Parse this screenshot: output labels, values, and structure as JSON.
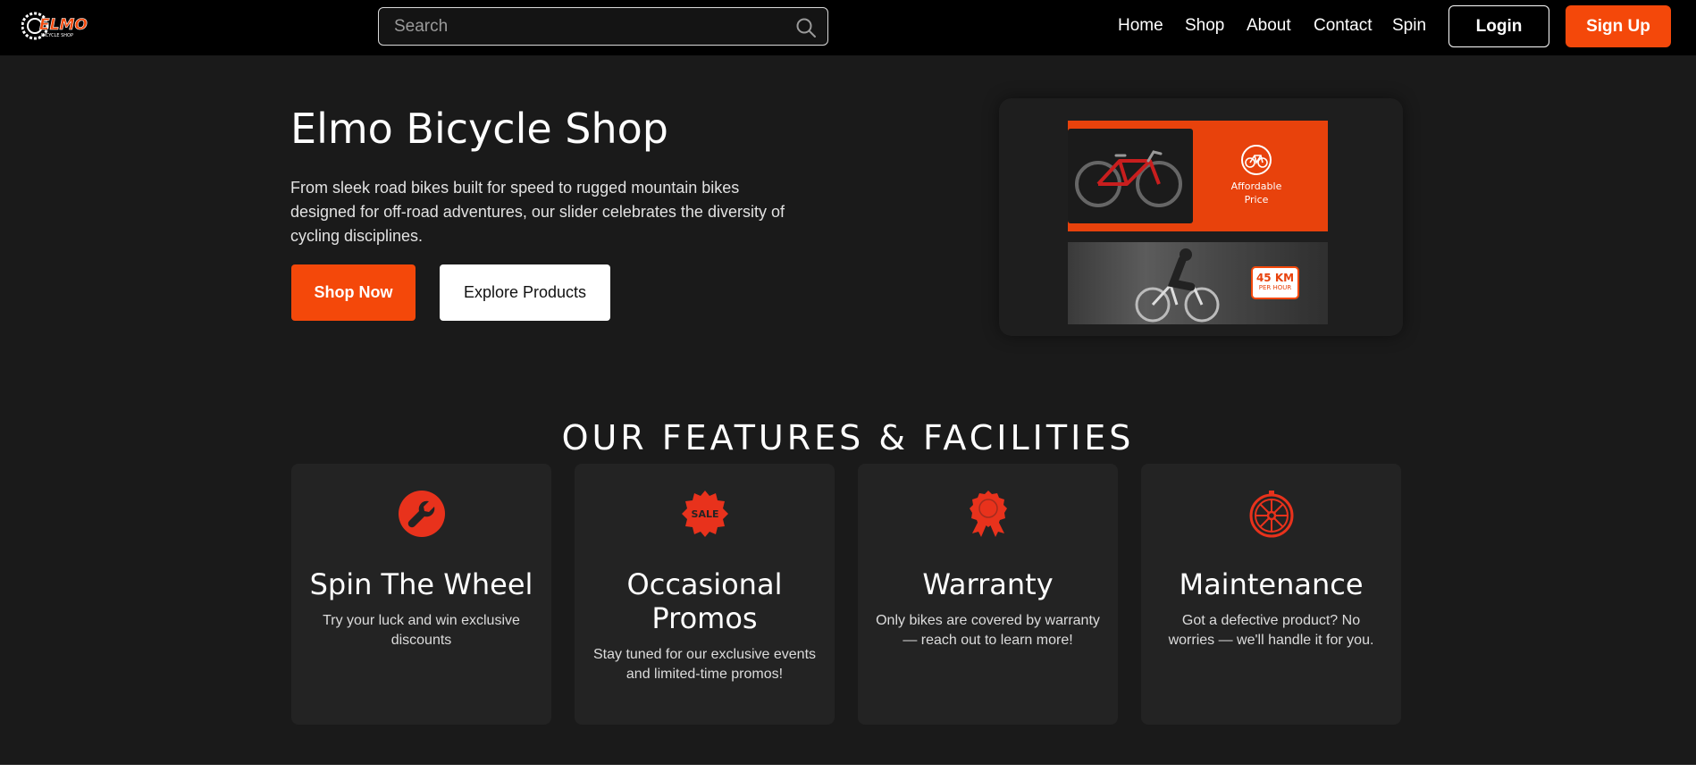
{
  "header": {
    "logo_text": "ELMO",
    "logo_subtext": "BICYCLE SHOP",
    "search_placeholder": "Search",
    "nav": [
      "Home",
      "Shop",
      "About",
      "Contact",
      "Spin"
    ],
    "login_label": "Login",
    "signup_label": "Sign Up"
  },
  "hero": {
    "title": "Elmo Bicycle Shop",
    "description": "From sleek road bikes built for speed to rugged mountain bikes designed for off-road adventures, our slider celebrates the diversity of cycling disciplines.",
    "shop_now_label": "Shop Now",
    "explore_label": "Explore Products",
    "visual": {
      "afford_line1": "Affordable",
      "afford_line2": "Price",
      "speed_value": "45 KM",
      "speed_unit": "PER HOUR"
    }
  },
  "features": {
    "heading": "OUR FEATURES & FACILITIES",
    "cards": [
      {
        "icon": "wrench-icon",
        "title": "Spin The Wheel",
        "desc": "Try your luck and win exclusive discounts"
      },
      {
        "icon": "sale-badge-icon",
        "title": "Occasional Promos",
        "desc": "Stay tuned for our exclusive events and limited-time promos!"
      },
      {
        "icon": "award-ribbon-icon",
        "title": "Warranty",
        "desc": "Only bikes are covered by warranty — reach out to learn more!"
      },
      {
        "icon": "wheel-icon",
        "title": "Maintenance",
        "desc": "Got a defective product? No worries — we'll handle it for you."
      }
    ]
  },
  "colors": {
    "accent": "#f4480a",
    "background": "#1a1a1a",
    "card": "#232323",
    "topbar": "#000000"
  }
}
